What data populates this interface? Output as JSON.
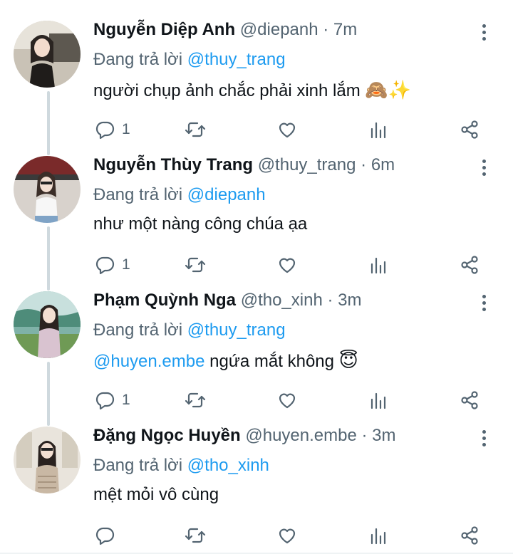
{
  "tweets": [
    {
      "name": "Nguyễn Diệp Anh",
      "handle": "@diepanh",
      "dot": "·",
      "time": "7m",
      "reply_prefix": "Đang trả lời",
      "reply_to": "@thuy_trang",
      "text_mention": "",
      "text": "người chụp ảnh chắc phải xinh lắm",
      "emoji": "🙈✨",
      "reply_count": "1",
      "avatar_icon": "profile-photo-woman-in-car"
    },
    {
      "name": "Nguyễn Thùy Trang",
      "handle": "@thuy_trang",
      "dot": "·",
      "time": "6m",
      "reply_prefix": "Đang trả lời",
      "reply_to": "@diepanh",
      "text_mention": "",
      "text": "như một nàng công chúa ạa",
      "emoji": "",
      "reply_count": "1",
      "avatar_icon": "profile-photo-woman-white-top"
    },
    {
      "name": "Phạm Quỳnh Nga",
      "handle": "@tho_xinh",
      "dot": "·",
      "time": "3m",
      "reply_prefix": "Đang trả lời",
      "reply_to": "@thuy_trang",
      "text_mention": "@huyen.embe",
      "text": " ngứa mắt không",
      "emoji": "😇",
      "reply_count": "1",
      "avatar_icon": "profile-photo-woman-by-lake"
    },
    {
      "name": "Đặng Ngọc Huyền",
      "handle": "@huyen.embe",
      "dot": "·",
      "time": "3m",
      "reply_prefix": "Đang trả lời",
      "reply_to": "@tho_xinh",
      "text_mention": "",
      "text": "mệt mỏi vô cùng",
      "emoji": "",
      "reply_count": "",
      "avatar_icon": "profile-photo-woman-indoors"
    }
  ],
  "colors": {
    "mention": "#1d9bf0",
    "secondary_text": "#536471",
    "thread_line": "#cfd9de"
  },
  "action_icons": [
    "reply-icon",
    "retweet-icon",
    "like-icon",
    "analytics-icon",
    "share-icon"
  ]
}
